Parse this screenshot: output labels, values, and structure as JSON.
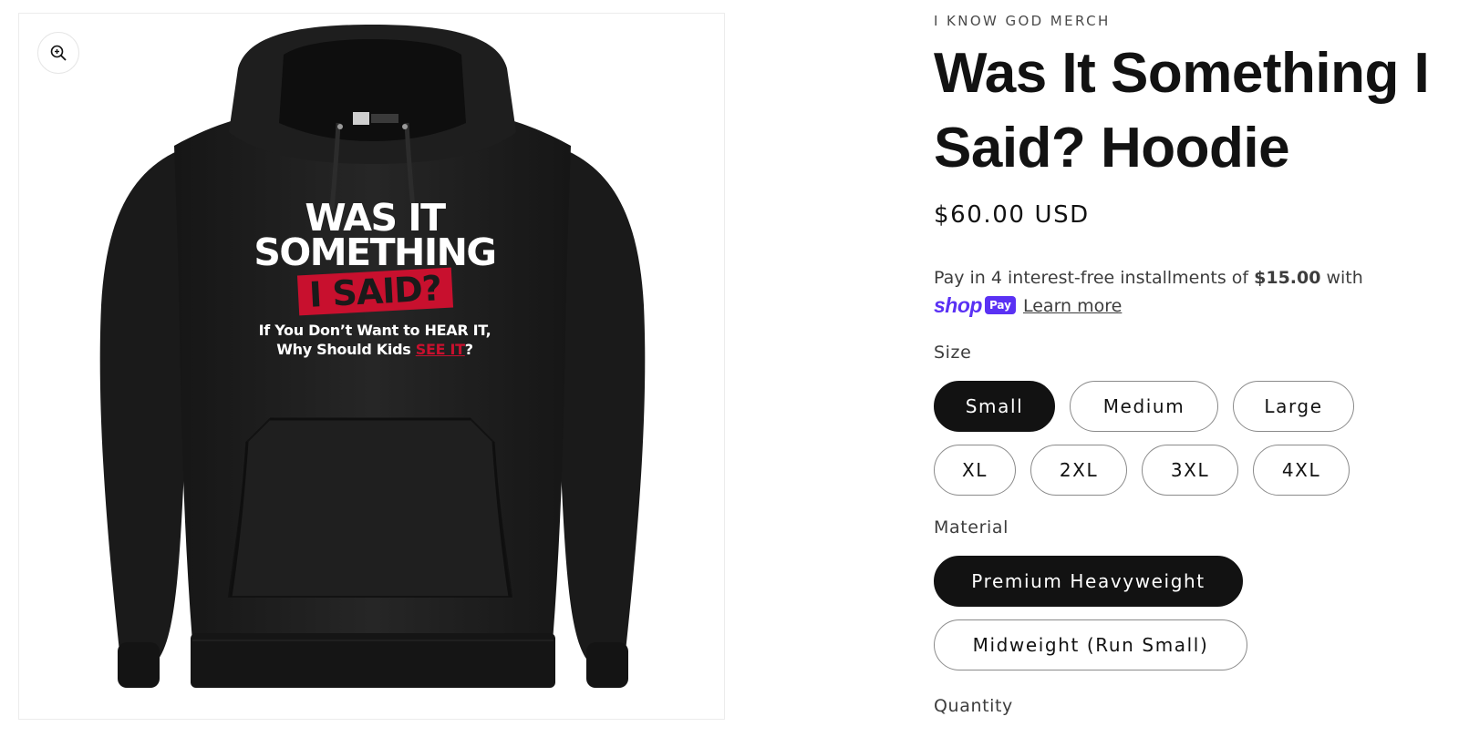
{
  "media": {
    "zoom_icon": "zoom-in-icon",
    "print": {
      "line1": "WAS IT",
      "line2": "SOMETHING",
      "line3": "I SAID?",
      "sub1": "If You Don’t Want to HEAR IT,",
      "sub2_prefix": "Why Should Kids ",
      "sub2_red": "SEE IT",
      "sub2_suffix": "?"
    },
    "colors": {
      "hoodie": "#1c1c1c",
      "accent_red": "#c8102e"
    }
  },
  "product": {
    "vendor": "I KNOW GOD MERCH",
    "title": "Was It Something I Said? Hoodie",
    "price": "$60.00 USD",
    "installments": {
      "prefix": "Pay in 4 interest-free installments of ",
      "amount": "$15.00",
      "suffix": " with",
      "shop_word": "shop",
      "pay_badge": "Pay",
      "learn_more": "Learn more"
    },
    "size": {
      "label": "Size",
      "selected": "Small",
      "options": [
        "Small",
        "Medium",
        "Large",
        "XL",
        "2XL",
        "3XL",
        "4XL"
      ]
    },
    "material": {
      "label": "Material",
      "selected": "Premium Heavyweight",
      "options": [
        "Premium Heavyweight",
        "Midweight (Run Small)"
      ]
    },
    "quantity": {
      "label": "Quantity"
    }
  },
  "colors": {
    "text": "#121212",
    "selected_bg": "#121212",
    "shop_pay": "#5a31f4"
  }
}
